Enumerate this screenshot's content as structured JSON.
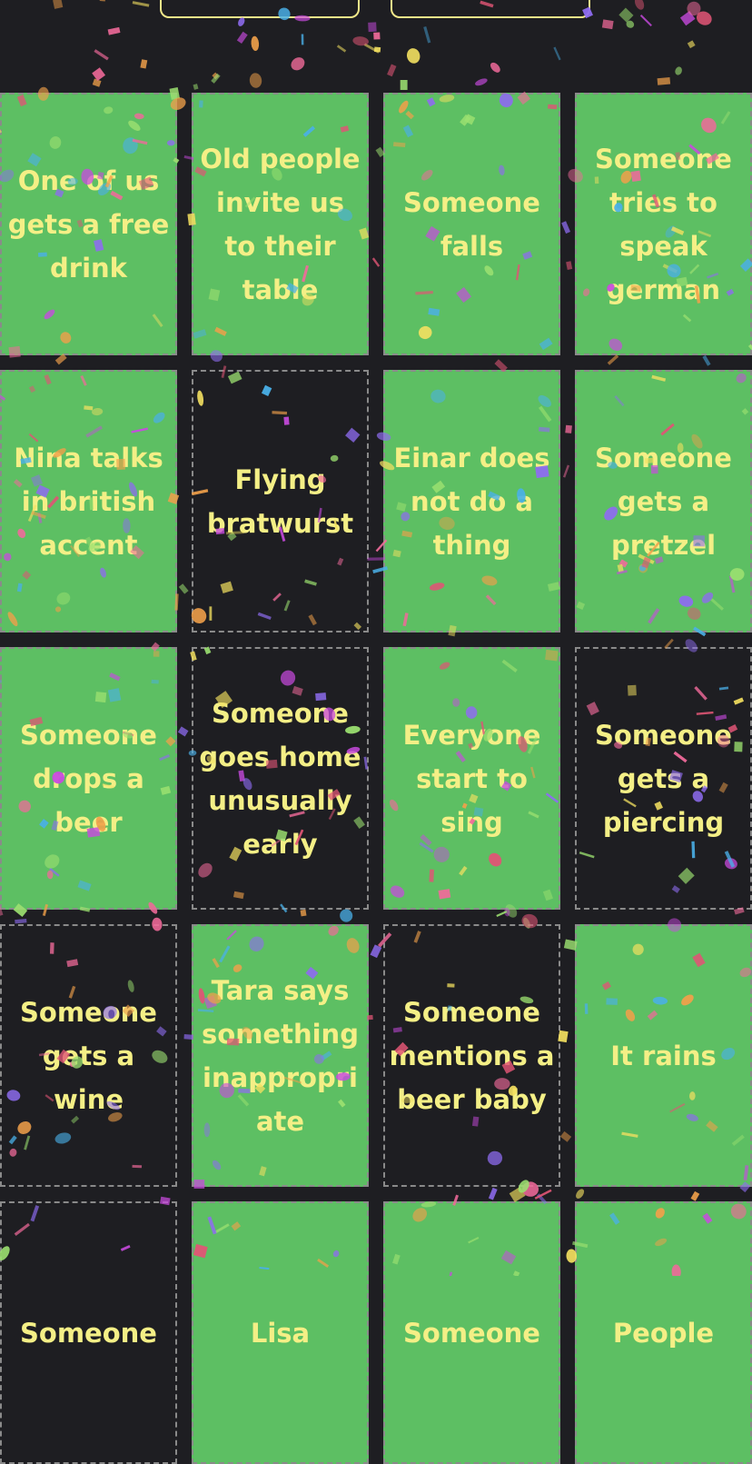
{
  "colors": {
    "background": "#1e1e22",
    "checked_cell": "#5dbf63",
    "text": "#f4ef86",
    "border": "#8a8a8a"
  },
  "top_buttons": [
    "",
    ""
  ],
  "cells": [
    {
      "label": "One of us gets a free drink",
      "checked": true
    },
    {
      "label": "Old people invite us to their table",
      "checked": true
    },
    {
      "label": "Someone falls",
      "checked": true
    },
    {
      "label": "Someone tries to speak german",
      "checked": true
    },
    {
      "label": "Nina talks in british accent",
      "checked": true
    },
    {
      "label": "Flying bratwurst",
      "checked": false
    },
    {
      "label": "Einar does not do a thing",
      "checked": true
    },
    {
      "label": "Someone gets a pretzel",
      "checked": true
    },
    {
      "label": "Someone drops a beer",
      "checked": true
    },
    {
      "label": "Someone goes home unusually early",
      "checked": false
    },
    {
      "label": "Everyone start to sing",
      "checked": true
    },
    {
      "label": "Someone gets a piercing",
      "checked": false
    },
    {
      "label": "Someone gets a wine",
      "checked": false
    },
    {
      "label": "Tara says something inappropriate",
      "checked": true
    },
    {
      "label": "Someone mentions a beer baby",
      "checked": false
    },
    {
      "label": "It rains",
      "checked": true
    },
    {
      "label": "Someone",
      "checked": false
    },
    {
      "label": "Lisa",
      "checked": true
    },
    {
      "label": "Someone",
      "checked": true
    },
    {
      "label": "People",
      "checked": true
    }
  ],
  "confetti_colors": [
    "#c94ae0",
    "#e05575",
    "#f0a04a",
    "#f3e060",
    "#4ab0e8",
    "#8e6cf0",
    "#9be070",
    "#f06a9a"
  ]
}
